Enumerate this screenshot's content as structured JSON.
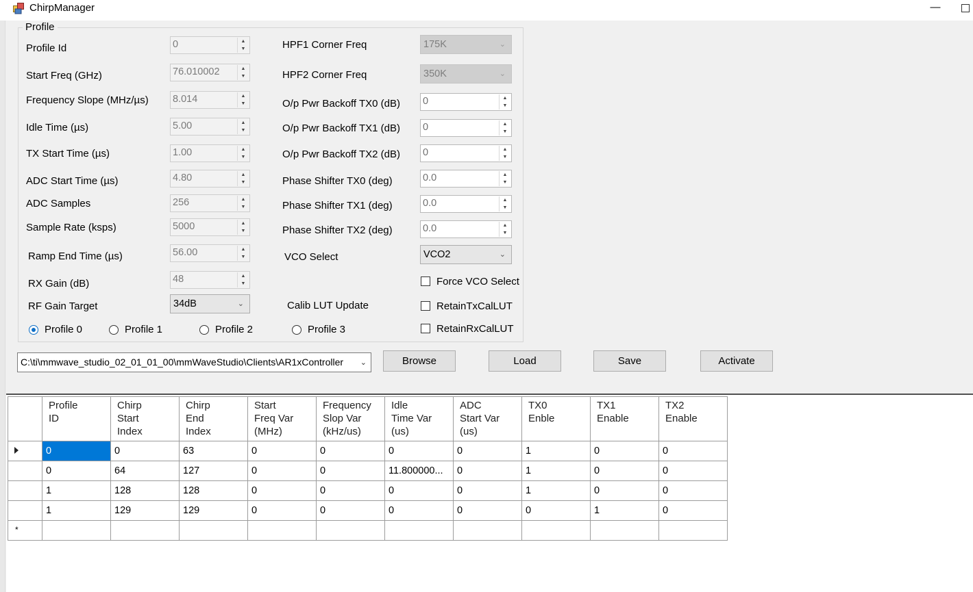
{
  "window": {
    "title": "ChirpManager",
    "minimize_glyph": "—"
  },
  "profile": {
    "group_title": "Profile",
    "left_fields": [
      {
        "label": "Profile Id",
        "value": "0"
      },
      {
        "label": "Start Freq (GHz)",
        "value": "76.010002"
      },
      {
        "label": "Frequency Slope (MHz/µs)",
        "value": "8.014"
      },
      {
        "label": "Idle Time (µs)",
        "value": "5.00"
      },
      {
        "label": "TX Start Time (µs)",
        "value": "1.00"
      },
      {
        "label": "ADC Start Time (µs)",
        "value": "4.80"
      },
      {
        "label": "ADC Samples",
        "value": "256"
      },
      {
        "label": "Sample Rate (ksps)",
        "value": "5000"
      },
      {
        "label": "Ramp End Time (µs)",
        "value": "56.00"
      },
      {
        "label": "RX Gain (dB)",
        "value": "48"
      }
    ],
    "rf_gain": {
      "label": "RF Gain Target",
      "value": "34dB"
    },
    "hpf1": {
      "label": "HPF1 Corner Freq",
      "value": "175K"
    },
    "hpf2": {
      "label": "HPF2 Corner Freq",
      "value": "350K"
    },
    "right_fields": [
      {
        "label": "O/p Pwr Backoff TX0 (dB)",
        "value": "0"
      },
      {
        "label": "O/p Pwr Backoff TX1 (dB)",
        "value": "0"
      },
      {
        "label": "O/p Pwr Backoff TX2 (dB)",
        "value": "0"
      },
      {
        "label": "Phase Shifter TX0 (deg)",
        "value": "0.0"
      },
      {
        "label": "Phase Shifter TX1 (deg)",
        "value": "0.0"
      },
      {
        "label": "Phase Shifter TX2 (deg)",
        "value": "0.0"
      }
    ],
    "vco": {
      "label": "VCO Select",
      "value": "VCO2"
    },
    "force_vco": {
      "label": "Force VCO Select",
      "checked": false
    },
    "calib_lut_label": "Calib LUT Update",
    "retain_tx": {
      "label": "RetainTxCalLUT",
      "checked": false
    },
    "retain_rx": {
      "label": "RetainRxCalLUT",
      "checked": false
    },
    "radios": [
      {
        "label": "Profile 0",
        "selected": true
      },
      {
        "label": "Profile 1",
        "selected": false
      },
      {
        "label": "Profile 2",
        "selected": false
      },
      {
        "label": "Profile 3",
        "selected": false
      }
    ]
  },
  "file": {
    "path": "C:\\ti\\mmwave_studio_02_01_01_00\\mmWaveStudio\\Clients\\AR1xController",
    "browse_label": "Browse",
    "load_label": "Load",
    "save_label": "Save",
    "activate_label": "Activate"
  },
  "grid": {
    "columns": [
      "Profile\nID",
      "Chirp\nStart\nIndex",
      "Chirp\nEnd\nIndex",
      "Start\nFreq Var\n(MHz)",
      "Frequency\nSlop Var\n(kHz/us)",
      "Idle\nTime Var\n(us)",
      "ADC\nStart Var\n(us)",
      "TX0\nEnble",
      "TX1\nEnable",
      "TX2\nEnable"
    ],
    "rows": [
      [
        "0",
        "0",
        "63",
        "0",
        "0",
        "0",
        "0",
        "1",
        "0",
        "0"
      ],
      [
        "0",
        "64",
        "127",
        "0",
        "0",
        "11.800000...",
        "0",
        "1",
        "0",
        "0"
      ],
      [
        "1",
        "128",
        "128",
        "0",
        "0",
        "0",
        "0",
        "1",
        "0",
        "0"
      ],
      [
        "1",
        "129",
        "129",
        "0",
        "0",
        "0",
        "0",
        "0",
        "1",
        "0"
      ]
    ],
    "new_row_marker": "*"
  }
}
